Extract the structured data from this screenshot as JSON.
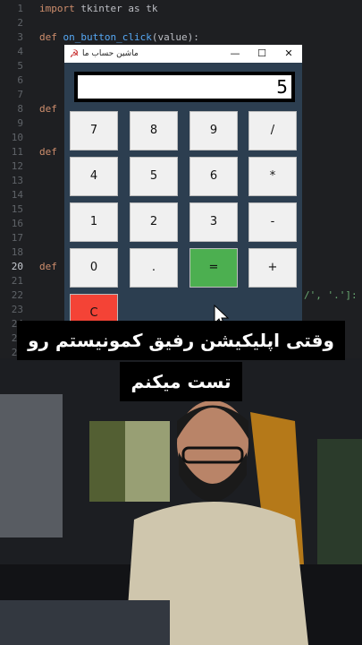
{
  "editor": {
    "line_numbers": [
      "1",
      "2",
      "3",
      "4",
      "5",
      "6",
      "7",
      "8",
      "9",
      "10",
      "11",
      "12",
      "13",
      "14",
      "15",
      "16",
      "17",
      "18",
      "19",
      "20",
      "21",
      "22",
      "23",
      "24",
      "25",
      "26"
    ],
    "current_line": "20",
    "code": {
      "l1_kw": "import",
      "l1_rest": " tkinter as tk",
      "l3_kw": "def",
      "l3_fn": " on_button_click",
      "l3_rest": "(value):",
      "l7_kw": "def",
      "l10_kw": "def",
      "l20_kw": "def",
      "l22_frag": "/', '.']:"
    }
  },
  "calculator_window": {
    "title": "ماشین حساب ما",
    "icon": "hammer-sickle-icon",
    "minimize_label": "—",
    "maximize_label": "☐",
    "close_label": "✕",
    "display_value": "5",
    "keys": {
      "k7": "7",
      "k8": "8",
      "k9": "9",
      "div": "/",
      "k4": "4",
      "k5": "5",
      "k6": "6",
      "mul": "*",
      "k1": "1",
      "k2": "2",
      "k3": "3",
      "sub": "-",
      "k0": "0",
      "dot": ".",
      "eq": "=",
      "add": "+",
      "clr": "C"
    },
    "colors": {
      "background": "#2c3e50",
      "equals": "#4caf50",
      "clear": "#f44336"
    }
  },
  "caption": {
    "line1": "وقتی اپلیکیشن رفیق کمونیستم رو",
    "line2": "تست میکنم"
  }
}
